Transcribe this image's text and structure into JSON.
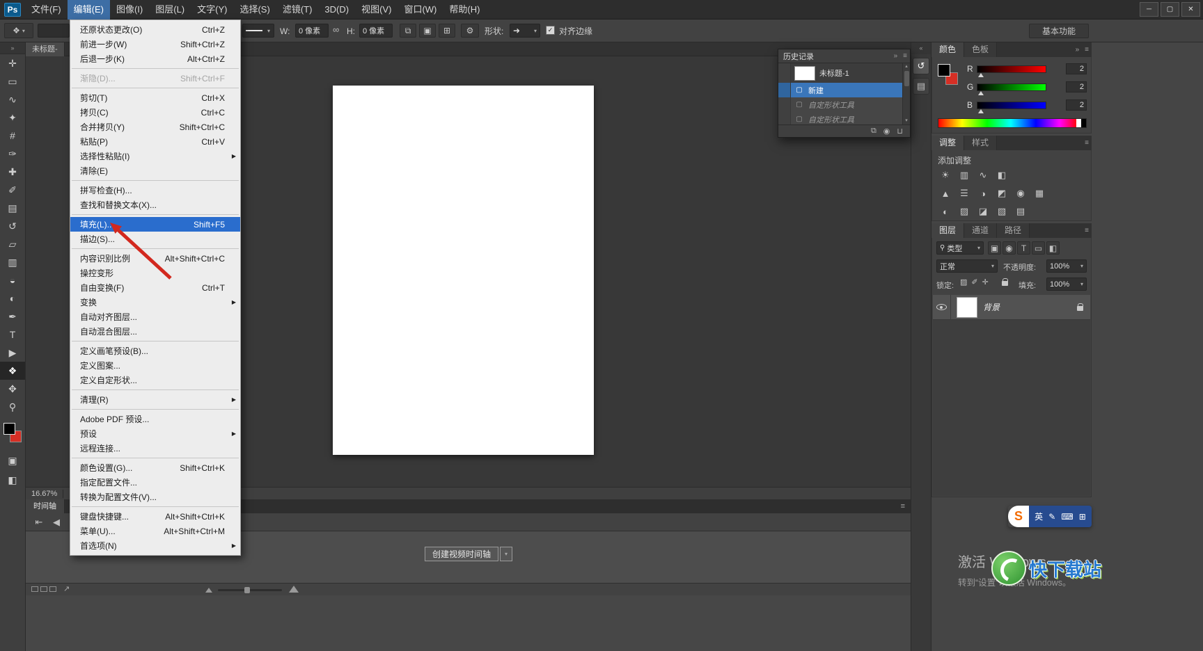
{
  "colors": {
    "accent_blue": "#2a6dcd",
    "history_selection_blue": "#3a76ba",
    "menubar_highlight": "#3d6ea5",
    "foreground_swatch": "#000000",
    "background_swatch": "#d62f25",
    "document_fill": "#ffffff"
  },
  "ui": {
    "caret": "▾",
    "check": "✓",
    "collapse": "»",
    "collapse_left": "«",
    "panel_menu": "≡",
    "up": "▴",
    "down": "▾",
    "diag_arrow": "↗"
  },
  "titlebar": {
    "logo": "Ps",
    "menus": [
      {
        "label": "文件(F)",
        "name": "menubar-item-file"
      },
      {
        "label": "编辑(E)",
        "name": "menubar-item-edit",
        "cls": "active"
      },
      {
        "label": "图像(I)",
        "name": "menubar-item-image"
      },
      {
        "label": "图层(L)",
        "name": "menubar-item-layer"
      },
      {
        "label": "文字(Y)",
        "name": "menubar-item-type"
      },
      {
        "label": "选择(S)",
        "name": "menubar-item-select"
      },
      {
        "label": "滤镜(T)",
        "name": "menubar-item-filter"
      },
      {
        "label": "3D(D)",
        "name": "menubar-item-3d"
      },
      {
        "label": "视图(V)",
        "name": "menubar-item-view"
      },
      {
        "label": "窗口(W)",
        "name": "menubar-item-window"
      },
      {
        "label": "帮助(H)",
        "name": "menubar-item-help"
      }
    ],
    "win_min": "─",
    "win_max": "▢",
    "win_close": "✕"
  },
  "options_bar": {
    "preset_glyph": "❖",
    "w_label": "W:",
    "w_value": "0 像素",
    "link_glyph": "∞",
    "h_label": "H:",
    "h_value": "0 像素",
    "op_icons": [
      {
        "g": "⧉",
        "name": "path-operations-icon"
      },
      {
        "g": "▣",
        "name": "path-alignment-icon"
      },
      {
        "g": "⊞",
        "name": "path-arrangement-icon"
      }
    ],
    "gear_glyph": "⚙",
    "shape_label": "形状:",
    "shape_glyph": "➜",
    "align_edges": "对齐边缘",
    "workspace": "基本功能"
  },
  "toolbar": {
    "collapse_glyph": "»",
    "tools": [
      {
        "g": "✛",
        "name": "move-tool"
      },
      {
        "g": "▭",
        "name": "rectangular-marquee-tool"
      },
      {
        "g": "∿",
        "name": "lasso-tool"
      },
      {
        "g": "✦",
        "name": "quick-selection-tool"
      },
      {
        "g": "#",
        "name": "crop-tool"
      },
      {
        "g": "✑",
        "name": "eyedropper-tool"
      },
      {
        "g": "✚",
        "name": "spot-healing-brush-tool"
      },
      {
        "g": "✐",
        "name": "brush-tool"
      },
      {
        "g": "▤",
        "name": "clone-stamp-tool"
      },
      {
        "g": "↺",
        "name": "history-brush-tool"
      },
      {
        "g": "▱",
        "name": "eraser-tool"
      },
      {
        "g": "▥",
        "name": "gradient-tool"
      },
      {
        "g": "◒",
        "name": "blur-tool"
      },
      {
        "g": "◐",
        "name": "dodge-tool"
      },
      {
        "g": "✒",
        "name": "pen-tool"
      },
      {
        "g": "T",
        "name": "type-tool"
      },
      {
        "g": "▶",
        "name": "path-selection-tool"
      },
      {
        "g": "❖",
        "name": "custom-shape-tool",
        "cls": "active"
      },
      {
        "g": "✥",
        "name": "hand-tool"
      },
      {
        "g": "⚲",
        "name": "zoom-tool"
      }
    ],
    "mask_glyph": "▣",
    "screen_glyph": "◧"
  },
  "document": {
    "tab": "未标题-",
    "zoom": "16.67%"
  },
  "edit_menu": {
    "items": [
      {
        "label": "还原状态更改(O)",
        "shortcut": "Ctrl+Z",
        "name": "menu-item-undo"
      },
      {
        "label": "前进一步(W)",
        "shortcut": "Shift+Ctrl+Z",
        "name": "menu-item-step-forward"
      },
      {
        "label": "后退一步(K)",
        "shortcut": "Alt+Ctrl+Z",
        "name": "menu-item-step-backward"
      },
      {
        "sep": true
      },
      {
        "label": "渐隐(D)...",
        "shortcut": "Shift+Ctrl+F",
        "cls": "disabled",
        "name": "menu-item-fade"
      },
      {
        "sep": true
      },
      {
        "label": "剪切(T)",
        "shortcut": "Ctrl+X",
        "name": "menu-item-cut"
      },
      {
        "label": "拷贝(C)",
        "shortcut": "Ctrl+C",
        "name": "menu-item-copy"
      },
      {
        "label": "合并拷贝(Y)",
        "shortcut": "Shift+Ctrl+C",
        "name": "menu-item-copy-merged"
      },
      {
        "label": "粘贴(P)",
        "shortcut": "Ctrl+V",
        "name": "menu-item-paste"
      },
      {
        "label": "选择性粘贴(I)",
        "arrow": "▶",
        "name": "menu-item-paste-special"
      },
      {
        "label": "清除(E)",
        "name": "menu-item-clear"
      },
      {
        "sep": true
      },
      {
        "label": "拼写检查(H)...",
        "name": "menu-item-check-spelling"
      },
      {
        "label": "查找和替换文本(X)...",
        "name": "menu-item-find-replace"
      },
      {
        "sep": true
      },
      {
        "label": "填充(L)...",
        "shortcut": "Shift+F5",
        "cls": "hl",
        "name": "menu-item-fill"
      },
      {
        "label": "描边(S)...",
        "name": "menu-item-stroke"
      },
      {
        "sep": true
      },
      {
        "label": "内容识别比例",
        "shortcut": "Alt+Shift+Ctrl+C",
        "name": "menu-item-content-aware-scale"
      },
      {
        "label": "操控变形",
        "name": "menu-item-puppet-warp"
      },
      {
        "label": "自由变换(F)",
        "shortcut": "Ctrl+T",
        "name": "menu-item-free-transform"
      },
      {
        "label": "变换",
        "arrow": "▶",
        "name": "menu-item-transform"
      },
      {
        "label": "自动对齐图层...",
        "name": "menu-item-auto-align-layers"
      },
      {
        "label": "自动混合图层...",
        "name": "menu-item-auto-blend-layers"
      },
      {
        "sep": true
      },
      {
        "label": "定义画笔预设(B)...",
        "name": "menu-item-define-brush-preset"
      },
      {
        "label": "定义图案...",
        "name": "menu-item-define-pattern"
      },
      {
        "label": "定义自定形状...",
        "name": "menu-item-define-custom-shape"
      },
      {
        "sep": true
      },
      {
        "label": "清理(R)",
        "arrow": "▶",
        "name": "menu-item-purge"
      },
      {
        "sep": true
      },
      {
        "label": "Adobe PDF 预设...",
        "name": "menu-item-adobe-pdf-presets"
      },
      {
        "label": "预设",
        "arrow": "▶",
        "name": "menu-item-presets"
      },
      {
        "label": "远程连接...",
        "name": "menu-item-remote-connections"
      },
      {
        "sep": true
      },
      {
        "label": "颜色设置(G)...",
        "shortcut": "Shift+Ctrl+K",
        "name": "menu-item-color-settings"
      },
      {
        "label": "指定配置文件...",
        "name": "menu-item-assign-profile"
      },
      {
        "label": "转换为配置文件(V)...",
        "name": "menu-item-convert-to-profile"
      },
      {
        "sep": true
      },
      {
        "label": "键盘快捷键...",
        "shortcut": "Alt+Shift+Ctrl+K",
        "name": "menu-item-keyboard-shortcuts"
      },
      {
        "label": "菜单(U)...",
        "shortcut": "Alt+Shift+Ctrl+M",
        "name": "menu-item-menus"
      },
      {
        "label": "首选项(N)",
        "arrow": "▶",
        "name": "menu-item-preferences"
      }
    ]
  },
  "history": {
    "title": "历史记录",
    "items": [
      {
        "label": "未标题-1",
        "cls": "snap",
        "name": "history-snapshot-untitled-1"
      },
      {
        "label": "新建",
        "icon": "▢",
        "cls": "sel",
        "name": "history-state-new"
      },
      {
        "label": "自定形状工具",
        "icon": "▢",
        "cls": "undone",
        "name": "history-state-custom-shape-tool"
      },
      {
        "label": "自定形状工具",
        "icon": "▢",
        "cls": "undone",
        "name": "history-state-custom-shape-tool"
      }
    ],
    "bottom": [
      {
        "g": "⧉",
        "name": "new-document-from-state-icon"
      },
      {
        "g": "◉",
        "name": "new-snapshot-icon"
      },
      {
        "g": "⊔",
        "name": "delete-state-icon"
      }
    ]
  },
  "color_panel": {
    "tabs": [
      {
        "label": "颜色",
        "cls": "active",
        "name": "tab-color"
      },
      {
        "label": "色板",
        "name": "tab-swatches"
      }
    ],
    "channels": [
      {
        "label": "R",
        "value": "2",
        "cls": "r",
        "name": "red-channel-row"
      },
      {
        "label": "G",
        "value": "2",
        "cls": "g",
        "name": "green-channel-row"
      },
      {
        "label": "B",
        "value": "2",
        "cls": "b",
        "name": "blue-channel-row"
      }
    ]
  },
  "adjustments": {
    "tabs": [
      {
        "label": "调整",
        "cls": "active",
        "name": "tab-adjustments"
      },
      {
        "label": "样式",
        "name": "tab-styles"
      }
    ],
    "heading": "添加调整",
    "row1": [
      {
        "g": "☀",
        "name": "brightness-contrast-icon"
      },
      {
        "g": "▥",
        "name": "levels-icon"
      },
      {
        "g": "∿",
        "name": "curves-icon"
      },
      {
        "g": "◧",
        "name": "exposure-icon"
      }
    ],
    "row2": [
      {
        "g": "▲",
        "name": "vibrance-icon"
      },
      {
        "g": "☰",
        "name": "hue-saturation-icon"
      },
      {
        "g": "◑",
        "name": "color-balance-icon"
      },
      {
        "g": "◩",
        "name": "black-white-icon"
      },
      {
        "g": "◉",
        "name": "photo-filter-icon"
      },
      {
        "g": "▦",
        "name": "channel-mixer-icon"
      }
    ],
    "row3": [
      {
        "g": "◐",
        "name": "invert-icon"
      },
      {
        "g": "▨",
        "name": "posterize-icon"
      },
      {
        "g": "◪",
        "name": "threshold-icon"
      },
      {
        "g": "▧",
        "name": "gradient-map-icon"
      },
      {
        "g": "▤",
        "name": "selective-color-icon"
      }
    ]
  },
  "layers_panel": {
    "tabs": [
      {
        "label": "图层",
        "cls": "active",
        "name": "tab-layers"
      },
      {
        "label": "通道",
        "name": "tab-channels"
      },
      {
        "label": "路径",
        "name": "tab-paths"
      }
    ],
    "search_glyph": "⚲",
    "filter_label": "类型",
    "filter_icons": [
      {
        "g": "▣",
        "name": "filter-pixel-layers-icon"
      },
      {
        "g": "◉",
        "name": "filter-adjustment-layers-icon"
      },
      {
        "g": "T",
        "name": "filter-type-layers-icon"
      },
      {
        "g": "▭",
        "name": "filter-shape-layers-icon"
      },
      {
        "g": "◧",
        "name": "filter-smart-objects-icon"
      }
    ],
    "blend_mode": "正常",
    "opacity_label": "不透明度:",
    "opacity_value": "100%",
    "lock_label": "锁定:",
    "lock_icons": [
      {
        "g": "▨",
        "name": "lock-transparent-pixels-icon"
      },
      {
        "g": "✐",
        "name": "lock-image-pixels-icon"
      },
      {
        "g": "✛",
        "name": "lock-position-icon"
      }
    ],
    "fill_label": "填充:",
    "fill_value": "100%",
    "layer_name": "背景"
  },
  "minidock": {
    "buttons": [
      {
        "g": "↺",
        "name": "history-panel-dock-icon",
        "cls": "pressed"
      },
      {
        "g": "▤",
        "name": "properties-panel-dock-icon"
      }
    ]
  },
  "timeline": {
    "tab": "时间轴",
    "transport": [
      {
        "g": "⇤",
        "name": "first-frame-button"
      },
      {
        "g": "◀",
        "name": "previous-frame-button"
      },
      {
        "g": "▶",
        "name": "play-button"
      },
      {
        "g": "⇥",
        "name": "next-frame-button"
      }
    ],
    "scissors": "✂",
    "transition_glyph": "◫",
    "create_button": "创建视频时间轴"
  },
  "ime": {
    "logo": "S",
    "items": [
      {
        "g": "英",
        "name": "ime-language-indicator"
      },
      {
        "g": "✎",
        "name": "ime-pen-icon"
      },
      {
        "g": "⌨",
        "name": "ime-keyboard-icon"
      },
      {
        "g": "⊞",
        "name": "ime-toolbox-icon"
      }
    ]
  },
  "watermarks": {
    "activate_title": "激活 Windows",
    "activate_sub": "转到“设置”以激活 Windows。",
    "site_name": "快下载站"
  }
}
